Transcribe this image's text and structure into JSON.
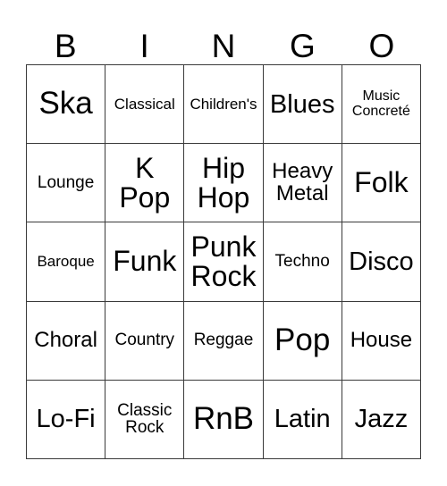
{
  "card": {
    "header": {
      "letters": [
        "B",
        "I",
        "N",
        "G",
        "O"
      ]
    },
    "columns": 5,
    "rows": 5,
    "colors": {
      "background": "#ffffff",
      "border": "#3a3a3a",
      "text": "#000000"
    },
    "cells": [
      {
        "text": "Ska",
        "size": "fs-xl"
      },
      {
        "text": "Classical",
        "size": "fs-xxs"
      },
      {
        "text": "Children's",
        "size": "fs-xxs"
      },
      {
        "text": "Blues",
        "size": "fs-md"
      },
      {
        "text": "Music\nConcreté",
        "size": "fs-tiny"
      },
      {
        "text": "Lounge",
        "size": "fs-xs"
      },
      {
        "text": "K\nPop",
        "size": "fs-lg"
      },
      {
        "text": "Hip\nHop",
        "size": "fs-lg"
      },
      {
        "text": "Heavy\nMetal",
        "size": "fs-sm"
      },
      {
        "text": "Folk",
        "size": "fs-lg"
      },
      {
        "text": "Baroque",
        "size": "fs-xxs"
      },
      {
        "text": "Funk",
        "size": "fs-lg"
      },
      {
        "text": "Punk\nRock",
        "size": "fs-lg"
      },
      {
        "text": "Techno",
        "size": "fs-xs"
      },
      {
        "text": "Disco",
        "size": "fs-md"
      },
      {
        "text": "Choral",
        "size": "fs-sm"
      },
      {
        "text": "Country",
        "size": "fs-xs"
      },
      {
        "text": "Reggae",
        "size": "fs-xs"
      },
      {
        "text": "Pop",
        "size": "fs-xl"
      },
      {
        "text": "House",
        "size": "fs-sm"
      },
      {
        "text": "Lo-Fi",
        "size": "fs-md"
      },
      {
        "text": "Classic\nRock",
        "size": "fs-xs"
      },
      {
        "text": "RnB",
        "size": "fs-xl"
      },
      {
        "text": "Latin",
        "size": "fs-md"
      },
      {
        "text": "Jazz",
        "size": "fs-md"
      }
    ]
  }
}
